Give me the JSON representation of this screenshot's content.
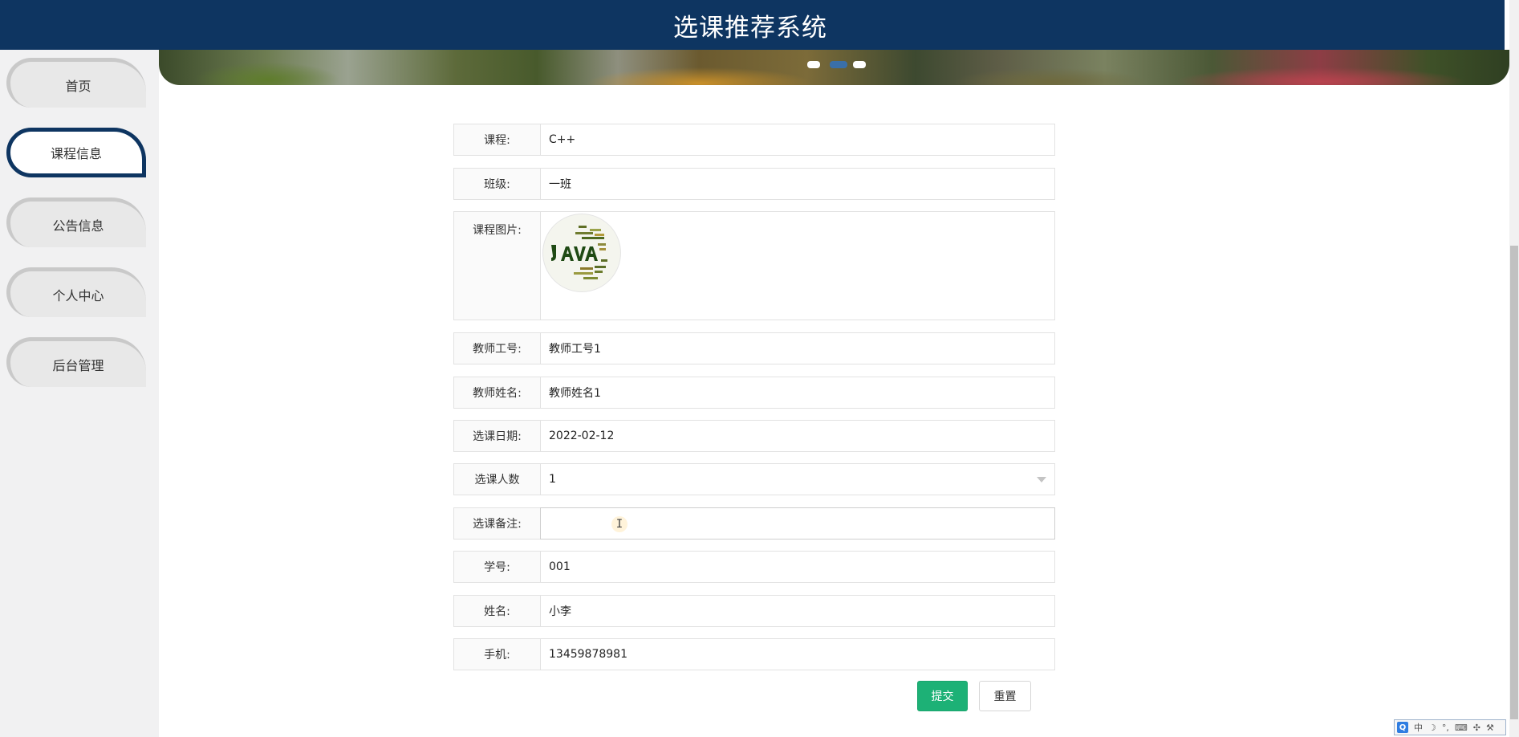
{
  "header": {
    "title": "选课推荐系统"
  },
  "sidebar": {
    "items": [
      {
        "label": "首页"
      },
      {
        "label": "课程信息"
      },
      {
        "label": "公告信息"
      },
      {
        "label": "个人中心"
      },
      {
        "label": "后台管理"
      }
    ],
    "active_index": 1
  },
  "banner": {
    "dots": 3,
    "active_dot": 1
  },
  "form": {
    "course": {
      "label": "课程:",
      "value": "C++"
    },
    "class": {
      "label": "班级:",
      "value": "一班"
    },
    "image": {
      "label": "课程图片:",
      "alt_text": "Java"
    },
    "teacher_id": {
      "label": "教师工号:",
      "value": "教师工号1"
    },
    "teacher_name": {
      "label": "教师姓名:",
      "value": "教师姓名1"
    },
    "date": {
      "label": "选课日期:",
      "value": "2022-02-12"
    },
    "count": {
      "label": "选课人数",
      "value": "1"
    },
    "remark": {
      "label": "选课备注:",
      "value": ""
    },
    "student_id": {
      "label": "学号:",
      "value": "001"
    },
    "name": {
      "label": "姓名:",
      "value": "小李"
    },
    "phone": {
      "label": "手机:",
      "value": "13459878981"
    }
  },
  "buttons": {
    "submit": "提交",
    "reset": "重置"
  },
  "ime": {
    "logo": "Q",
    "mode": "中"
  },
  "colors": {
    "header": "#0e3561",
    "submit": "#1db176",
    "sidebar": "#f1f1f2"
  }
}
